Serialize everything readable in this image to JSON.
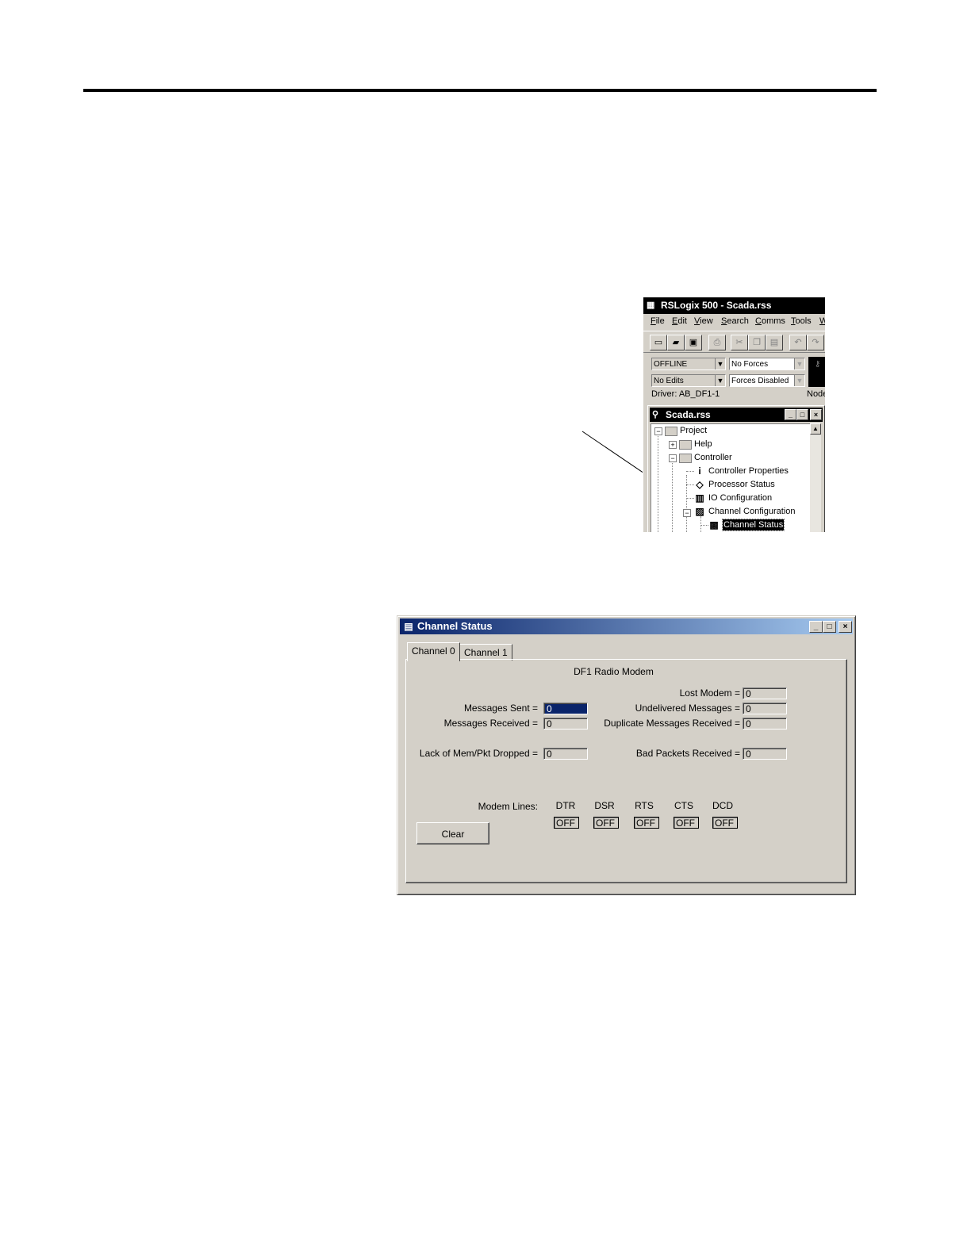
{
  "rslogix": {
    "title": "RSLogix 500 - Scada.rss",
    "menu": [
      "File",
      "Edit",
      "View",
      "Search",
      "Comms",
      "Tools",
      "W"
    ],
    "mode_combo": "OFFLINE",
    "forces_combo": "No Forces",
    "edits_combo": "No Edits",
    "forces_enabled_combo": "Forces Disabled",
    "driver": "Driver: AB_DF1-1",
    "node": "Node",
    "project_window": {
      "title": "Scada.rss",
      "tree": [
        "Project",
        "Help",
        "Controller",
        "Controller Properties",
        "Processor Status",
        "IO Configuration",
        "Channel Configuration",
        "Channel Status"
      ]
    }
  },
  "channel_status": {
    "title": "Channel Status",
    "tabs": [
      "Channel 0",
      "Channel 1"
    ],
    "mode": "DF1 Radio Modem",
    "fields": {
      "lost_modem_label": "Lost Modem =",
      "lost_modem": "0",
      "messages_sent_label": "Messages Sent =",
      "messages_sent": "0",
      "undelivered_label": "Undelivered Messages =",
      "undelivered": "0",
      "messages_received_label": "Messages Received =",
      "messages_received": "0",
      "duplicate_label": "Duplicate Messages Received =",
      "duplicate": "0",
      "lack_mem_label": "Lack of Mem/Pkt Dropped =",
      "lack_mem": "0",
      "bad_packets_label": "Bad Packets Received =",
      "bad_packets": "0"
    },
    "modem_lines": {
      "label": "Modem Lines:",
      "lines": [
        {
          "name": "DTR",
          "state": "OFF"
        },
        {
          "name": "DSR",
          "state": "OFF"
        },
        {
          "name": "RTS",
          "state": "OFF"
        },
        {
          "name": "CTS",
          "state": "OFF"
        },
        {
          "name": "DCD",
          "state": "OFF"
        }
      ]
    },
    "clear_label": "Clear"
  }
}
